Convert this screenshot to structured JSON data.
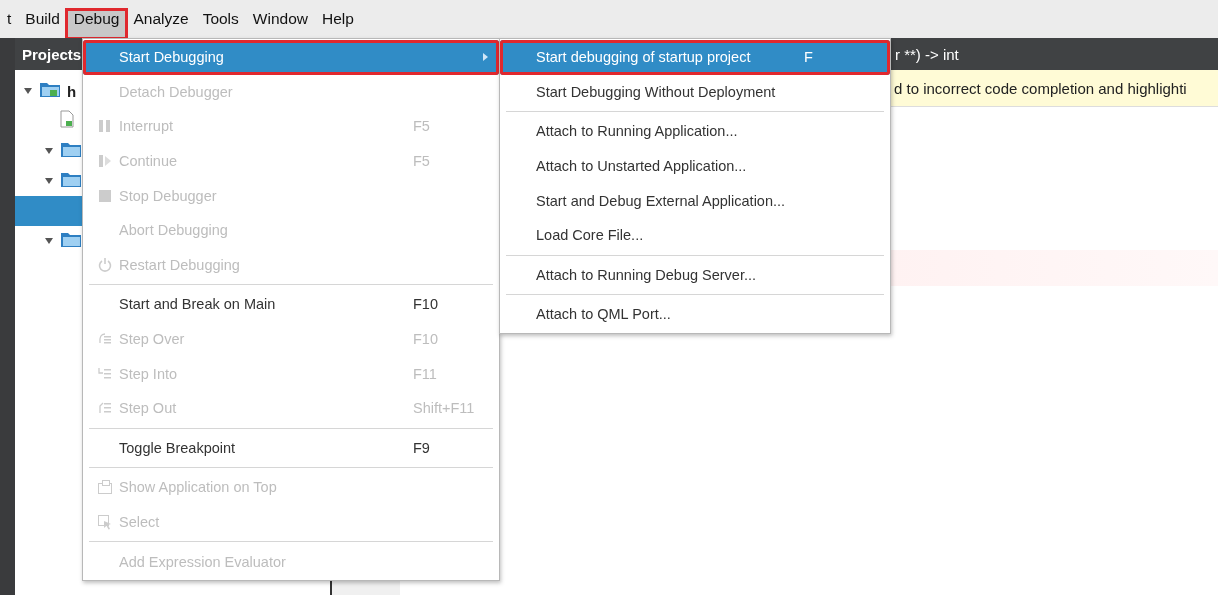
{
  "menubar": [
    {
      "label": "t",
      "selected": false,
      "highlighted": false
    },
    {
      "label": "Build",
      "selected": false,
      "highlighted": false
    },
    {
      "label": "Debug",
      "selected": true,
      "highlighted": true
    },
    {
      "label": "Analyze",
      "selected": false,
      "highlighted": false
    },
    {
      "label": "Tools",
      "selected": false,
      "highlighted": false
    },
    {
      "label": "Window",
      "selected": false,
      "highlighted": false
    },
    {
      "label": "Help",
      "selected": false,
      "highlighted": false
    }
  ],
  "projects": {
    "title": "Projects",
    "tree": [
      {
        "label": "h",
        "kind": "project",
        "expanded": true,
        "selected": false,
        "children": [
          {
            "kind": "file",
            "selected": false
          },
          {
            "kind": "folder",
            "expanded": true,
            "selected": false
          },
          {
            "kind": "folder",
            "expanded": true,
            "selected": false,
            "children": [
              {
                "selected": true
              }
            ]
          },
          {
            "kind": "folder",
            "expanded": true,
            "selected": false
          }
        ]
      }
    ]
  },
  "editor": {
    "signature": "r **) -> int",
    "warning": "d to incorrect code completion and highlighti"
  },
  "debug_menu": [
    {
      "kind": "item",
      "label": "Start Debugging",
      "disabled": false,
      "selected": true,
      "highlighted": true,
      "submenu": true
    },
    {
      "kind": "item",
      "label": "Detach Debugger",
      "disabled": true,
      "selected": false,
      "highlighted": false,
      "submenu": false
    },
    {
      "kind": "item",
      "label": "Interrupt",
      "shortcut": "F5",
      "disabled": true,
      "selected": false,
      "highlighted": false,
      "submenu": false
    },
    {
      "kind": "item",
      "label": "Continue",
      "shortcut": "F5",
      "disabled": true,
      "selected": false,
      "highlighted": false,
      "submenu": false
    },
    {
      "kind": "item",
      "label": "Stop Debugger",
      "disabled": true,
      "selected": false,
      "highlighted": false,
      "submenu": false
    },
    {
      "kind": "item",
      "label": "Abort Debugging",
      "disabled": true,
      "selected": false,
      "highlighted": false,
      "submenu": false
    },
    {
      "kind": "item",
      "label": "Restart Debugging",
      "disabled": true,
      "selected": false,
      "highlighted": false,
      "submenu": false
    },
    {
      "kind": "separator"
    },
    {
      "kind": "item",
      "label": "Start and Break on Main",
      "shortcut": "F10",
      "disabled": false,
      "selected": false,
      "highlighted": false,
      "submenu": false
    },
    {
      "kind": "item",
      "label": "Step Over",
      "shortcut": "F10",
      "disabled": true,
      "selected": false,
      "highlighted": false,
      "submenu": false
    },
    {
      "kind": "item",
      "label": "Step Into",
      "shortcut": "F11",
      "disabled": true,
      "selected": false,
      "highlighted": false,
      "submenu": false
    },
    {
      "kind": "item",
      "label": "Step Out",
      "shortcut": "Shift+F11",
      "disabled": true,
      "selected": false,
      "highlighted": false,
      "submenu": false
    },
    {
      "kind": "separator"
    },
    {
      "kind": "item",
      "label": "Toggle Breakpoint",
      "shortcut": "F9",
      "disabled": false,
      "selected": false,
      "highlighted": false,
      "submenu": false
    },
    {
      "kind": "separator"
    },
    {
      "kind": "item",
      "label": "Show Application on Top",
      "disabled": true,
      "selected": false,
      "highlighted": false,
      "submenu": false
    },
    {
      "kind": "item",
      "label": "Select",
      "disabled": true,
      "selected": false,
      "highlighted": false,
      "submenu": false
    },
    {
      "kind": "separator"
    },
    {
      "kind": "item",
      "label": "Add Expression Evaluator",
      "disabled": true,
      "selected": false,
      "highlighted": false,
      "submenu": false
    }
  ],
  "start_submenu": [
    {
      "kind": "item",
      "label": "Start debugging of startup project",
      "shortcut": "F",
      "disabled": false,
      "selected": true,
      "highlighted": true,
      "submenu": false
    },
    {
      "kind": "item",
      "label": "Start Debugging Without Deployment",
      "disabled": false,
      "selected": false,
      "highlighted": false,
      "submenu": false
    },
    {
      "kind": "separator"
    },
    {
      "kind": "item",
      "label": "Attach to Running Application...",
      "disabled": false,
      "selected": false,
      "highlighted": false,
      "submenu": false
    },
    {
      "kind": "item",
      "label": "Attach to Unstarted Application...",
      "disabled": false,
      "selected": false,
      "highlighted": false,
      "submenu": false
    },
    {
      "kind": "item",
      "label": "Start and Debug External Application...",
      "disabled": false,
      "selected": false,
      "highlighted": false,
      "submenu": false
    },
    {
      "kind": "item",
      "label": "Load Core File...",
      "disabled": false,
      "selected": false,
      "highlighted": false,
      "submenu": false
    },
    {
      "kind": "separator"
    },
    {
      "kind": "item",
      "label": "Attach to Running Debug Server...",
      "disabled": false,
      "selected": false,
      "highlighted": false,
      "submenu": false
    },
    {
      "kind": "separator"
    },
    {
      "kind": "item",
      "label": "Attach to QML Port...",
      "disabled": false,
      "selected": false,
      "highlighted": false,
      "submenu": false
    }
  ]
}
